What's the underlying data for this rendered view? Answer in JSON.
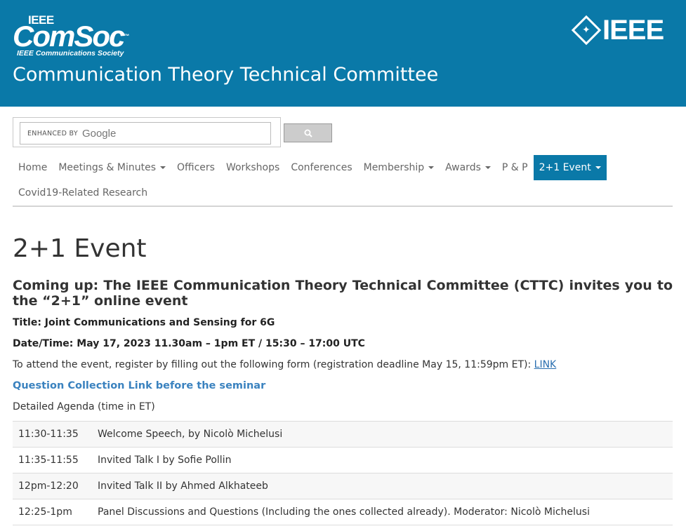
{
  "header": {
    "comsoc_ieee": "IEEE",
    "comsoc_word": "ComSoc",
    "comsoc_tm": "™",
    "comsoc_tagline": "IEEE Communications Society",
    "ieee_logo": "IEEE",
    "committee_title": "Communication Theory Technical Committee",
    "background_color": "#0a79a8"
  },
  "search": {
    "enhanced_by": "ENHANCED BY",
    "google": "Google",
    "button_icon": "search-icon"
  },
  "nav": {
    "items": [
      {
        "label": "Home",
        "dropdown": false
      },
      {
        "label": "Meetings & Minutes",
        "dropdown": true
      },
      {
        "label": "Officers",
        "dropdown": false
      },
      {
        "label": "Workshops",
        "dropdown": false
      },
      {
        "label": "Conferences",
        "dropdown": false
      },
      {
        "label": "Membership",
        "dropdown": true
      },
      {
        "label": "Awards",
        "dropdown": true
      },
      {
        "label": "P & P",
        "dropdown": false
      },
      {
        "label": "2+1 Event",
        "dropdown": true,
        "active": true
      }
    ],
    "second_row": [
      {
        "label": "Covid19-Related Research"
      }
    ],
    "active_color": "#0a79a8"
  },
  "main": {
    "page_title": "2+1 Event",
    "headline": "Coming up: The IEEE Communication Theory Technical Committee (CTTC) invites you to the “2+1” online event",
    "title_line": "Title: Joint Communications and Sensing for 6G",
    "date_line": "Date/Time: May 17, 2023 11.30am – 1pm ET / 15:30 – 17:00 UTC",
    "register_text": "To attend the event, register by filling out the following form (registration deadline May 15, 11:59pm ET): ",
    "register_link": "LINK",
    "question_link": "Question Collection Link before the seminar",
    "agenda_label": "Detailed Agenda (time in ET)",
    "agenda": [
      {
        "time": "11:30-11:35",
        "desc": "Welcome Speech, by Nicolò Michelusi"
      },
      {
        "time": "11:35-11:55",
        "desc": "Invited Talk I by Sofie Pollin"
      },
      {
        "time": "12pm-12:20",
        "desc": "Invited Talk II by Ahmed Alkhateeb"
      },
      {
        "time": "12:25-1pm",
        "desc": "Panel Discussions and Questions (Including the ones collected already). Moderator: Nicolò Michelusi"
      }
    ]
  }
}
